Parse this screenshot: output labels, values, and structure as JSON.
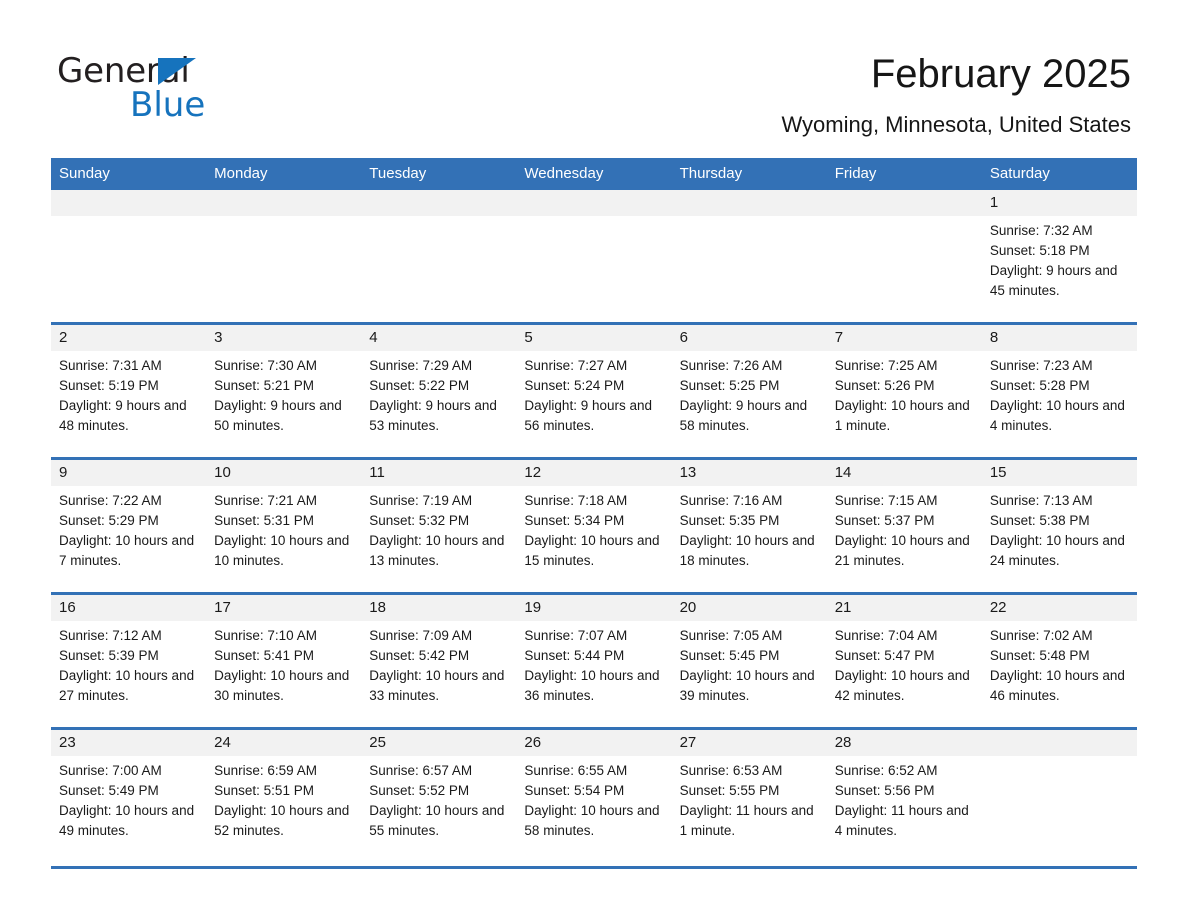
{
  "brand": {
    "name_part1": "General",
    "name_part2": "Blue",
    "triangle_icon": "triangle-icon",
    "accent_color": "#1673bd"
  },
  "header": {
    "month_title": "February 2025",
    "location": "Wyoming, Minnesota, United States",
    "header_bg_color": "#3371b6",
    "daynum_band_color": "#f2f2f2"
  },
  "weekday_headers": [
    "Sunday",
    "Monday",
    "Tuesday",
    "Wednesday",
    "Thursday",
    "Friday",
    "Saturday"
  ],
  "weeks": [
    [
      {
        "day": "",
        "sunrise": "",
        "sunset": "",
        "daylight": ""
      },
      {
        "day": "",
        "sunrise": "",
        "sunset": "",
        "daylight": ""
      },
      {
        "day": "",
        "sunrise": "",
        "sunset": "",
        "daylight": ""
      },
      {
        "day": "",
        "sunrise": "",
        "sunset": "",
        "daylight": ""
      },
      {
        "day": "",
        "sunrise": "",
        "sunset": "",
        "daylight": ""
      },
      {
        "day": "",
        "sunrise": "",
        "sunset": "",
        "daylight": ""
      },
      {
        "day": "1",
        "sunrise": "Sunrise: 7:32 AM",
        "sunset": "Sunset: 5:18 PM",
        "daylight": "Daylight: 9 hours and 45 minutes."
      }
    ],
    [
      {
        "day": "2",
        "sunrise": "Sunrise: 7:31 AM",
        "sunset": "Sunset: 5:19 PM",
        "daylight": "Daylight: 9 hours and 48 minutes."
      },
      {
        "day": "3",
        "sunrise": "Sunrise: 7:30 AM",
        "sunset": "Sunset: 5:21 PM",
        "daylight": "Daylight: 9 hours and 50 minutes."
      },
      {
        "day": "4",
        "sunrise": "Sunrise: 7:29 AM",
        "sunset": "Sunset: 5:22 PM",
        "daylight": "Daylight: 9 hours and 53 minutes."
      },
      {
        "day": "5",
        "sunrise": "Sunrise: 7:27 AM",
        "sunset": "Sunset: 5:24 PM",
        "daylight": "Daylight: 9 hours and 56 minutes."
      },
      {
        "day": "6",
        "sunrise": "Sunrise: 7:26 AM",
        "sunset": "Sunset: 5:25 PM",
        "daylight": "Daylight: 9 hours and 58 minutes."
      },
      {
        "day": "7",
        "sunrise": "Sunrise: 7:25 AM",
        "sunset": "Sunset: 5:26 PM",
        "daylight": "Daylight: 10 hours and 1 minute."
      },
      {
        "day": "8",
        "sunrise": "Sunrise: 7:23 AM",
        "sunset": "Sunset: 5:28 PM",
        "daylight": "Daylight: 10 hours and 4 minutes."
      }
    ],
    [
      {
        "day": "9",
        "sunrise": "Sunrise: 7:22 AM",
        "sunset": "Sunset: 5:29 PM",
        "daylight": "Daylight: 10 hours and 7 minutes."
      },
      {
        "day": "10",
        "sunrise": "Sunrise: 7:21 AM",
        "sunset": "Sunset: 5:31 PM",
        "daylight": "Daylight: 10 hours and 10 minutes."
      },
      {
        "day": "11",
        "sunrise": "Sunrise: 7:19 AM",
        "sunset": "Sunset: 5:32 PM",
        "daylight": "Daylight: 10 hours and 13 minutes."
      },
      {
        "day": "12",
        "sunrise": "Sunrise: 7:18 AM",
        "sunset": "Sunset: 5:34 PM",
        "daylight": "Daylight: 10 hours and 15 minutes."
      },
      {
        "day": "13",
        "sunrise": "Sunrise: 7:16 AM",
        "sunset": "Sunset: 5:35 PM",
        "daylight": "Daylight: 10 hours and 18 minutes."
      },
      {
        "day": "14",
        "sunrise": "Sunrise: 7:15 AM",
        "sunset": "Sunset: 5:37 PM",
        "daylight": "Daylight: 10 hours and 21 minutes."
      },
      {
        "day": "15",
        "sunrise": "Sunrise: 7:13 AM",
        "sunset": "Sunset: 5:38 PM",
        "daylight": "Daylight: 10 hours and 24 minutes."
      }
    ],
    [
      {
        "day": "16",
        "sunrise": "Sunrise: 7:12 AM",
        "sunset": "Sunset: 5:39 PM",
        "daylight": "Daylight: 10 hours and 27 minutes."
      },
      {
        "day": "17",
        "sunrise": "Sunrise: 7:10 AM",
        "sunset": "Sunset: 5:41 PM",
        "daylight": "Daylight: 10 hours and 30 minutes."
      },
      {
        "day": "18",
        "sunrise": "Sunrise: 7:09 AM",
        "sunset": "Sunset: 5:42 PM",
        "daylight": "Daylight: 10 hours and 33 minutes."
      },
      {
        "day": "19",
        "sunrise": "Sunrise: 7:07 AM",
        "sunset": "Sunset: 5:44 PM",
        "daylight": "Daylight: 10 hours and 36 minutes."
      },
      {
        "day": "20",
        "sunrise": "Sunrise: 7:05 AM",
        "sunset": "Sunset: 5:45 PM",
        "daylight": "Daylight: 10 hours and 39 minutes."
      },
      {
        "day": "21",
        "sunrise": "Sunrise: 7:04 AM",
        "sunset": "Sunset: 5:47 PM",
        "daylight": "Daylight: 10 hours and 42 minutes."
      },
      {
        "day": "22",
        "sunrise": "Sunrise: 7:02 AM",
        "sunset": "Sunset: 5:48 PM",
        "daylight": "Daylight: 10 hours and 46 minutes."
      }
    ],
    [
      {
        "day": "23",
        "sunrise": "Sunrise: 7:00 AM",
        "sunset": "Sunset: 5:49 PM",
        "daylight": "Daylight: 10 hours and 49 minutes."
      },
      {
        "day": "24",
        "sunrise": "Sunrise: 6:59 AM",
        "sunset": "Sunset: 5:51 PM",
        "daylight": "Daylight: 10 hours and 52 minutes."
      },
      {
        "day": "25",
        "sunrise": "Sunrise: 6:57 AM",
        "sunset": "Sunset: 5:52 PM",
        "daylight": "Daylight: 10 hours and 55 minutes."
      },
      {
        "day": "26",
        "sunrise": "Sunrise: 6:55 AM",
        "sunset": "Sunset: 5:54 PM",
        "daylight": "Daylight: 10 hours and 58 minutes."
      },
      {
        "day": "27",
        "sunrise": "Sunrise: 6:53 AM",
        "sunset": "Sunset: 5:55 PM",
        "daylight": "Daylight: 11 hours and 1 minute."
      },
      {
        "day": "28",
        "sunrise": "Sunrise: 6:52 AM",
        "sunset": "Sunset: 5:56 PM",
        "daylight": "Daylight: 11 hours and 4 minutes."
      },
      {
        "day": "",
        "sunrise": "",
        "sunset": "",
        "daylight": ""
      }
    ]
  ]
}
